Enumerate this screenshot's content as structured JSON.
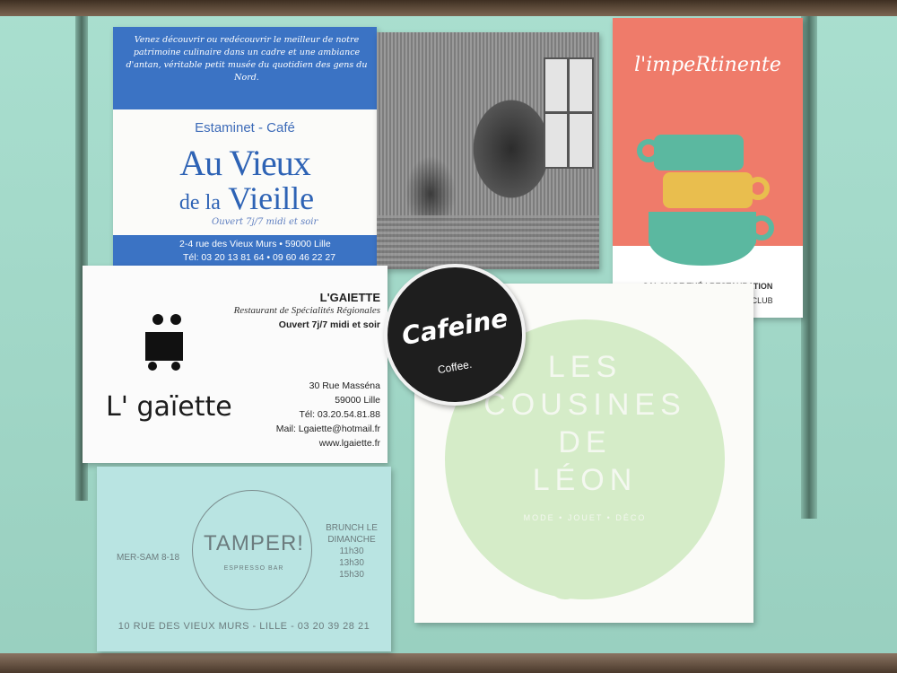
{
  "au_vieux": {
    "intro": "Venez découvrir ou redécouvrir le meilleur de notre patrimoine culinaire dans un cadre et une ambiance d'antan, véritable petit musée du quotidien des gens du Nord.",
    "subtitle": "Estaminet - Café",
    "name_line1": "Au Vieux",
    "name_line2_prefix": "de la",
    "name_line2": "Vieille",
    "hours": "Ouvert 7j/7 midi et soir",
    "address": "2-4 rue des Vieux Murs • 59000 Lille",
    "phones": "Tél: 03 20 13 81 64 • 09 60 46 22 27"
  },
  "impertinente": {
    "logo": "l'impeRtinente",
    "line1": "SALON DE THÉ | RESTAURATION ENTHOUSIASTE",
    "line2": "ÉPICERIE LOCALE | PONEY CLUB",
    "colors": {
      "top": "#ef7b6a",
      "cup_teal": "#5bb8a0",
      "cup_yellow": "#e9be4e"
    }
  },
  "gaiette": {
    "name": "L'GAIETTE",
    "specialty": "Restaurant de Spécialités Régionales",
    "open": "Ouvert 7j/7 midi et soir",
    "logo": "L' gaïette",
    "street": "30 Rue Masséna",
    "city": "59000 Lille",
    "tel": "Tél: 03.20.54.81.88",
    "mail": "Mail: Lgaiette@hotmail.fr",
    "web": "www.lgaiette.fr"
  },
  "tamper": {
    "logo": "TAMPER!",
    "tagline": "ESPRESSO BAR",
    "days": "MER-SAM 8-18",
    "brunch_title": "BRUNCH LE DIMANCHE",
    "brunch_times": [
      "11h30",
      "13h30",
      "15h30"
    ],
    "address": "10 RUE DES VIEUX MURS - LILLE - 03 20 39 28 21"
  },
  "cafeine": {
    "name": "Cafeine",
    "sub": "Coffee."
  },
  "cousines": {
    "line1": "LES",
    "line2": "COUSINES",
    "line3": "DE",
    "line4": "LÉON",
    "small": "MODE • JOUET • DÉCO"
  }
}
